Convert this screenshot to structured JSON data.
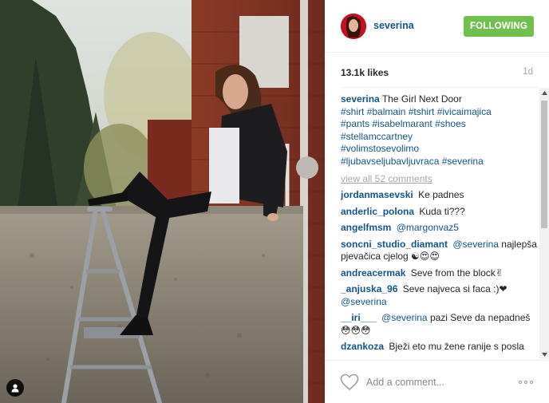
{
  "post": {
    "photo_label": "",
    "tag_icon": "person-tag-icon"
  },
  "header": {
    "username": "severina",
    "follow_label": "FOLLOWING",
    "follow_color": "#70c050"
  },
  "stats": {
    "likes": "13.1k likes",
    "age": "1d"
  },
  "caption": {
    "author": "severina",
    "text": "The Girl Next Door",
    "hashtag_lines": [
      "#shirt #balmain #tshirt #ivicaimajica",
      "#pants #isabelmarant #shoes",
      "#stellamccartney",
      "#volimstosevolimo",
      "#ljubavseljubavljuvraca #severina"
    ]
  },
  "view_all": "view all 52 comments",
  "comments": [
    {
      "user": "jordanmasevski",
      "mention": "",
      "text": "Ke padnes"
    },
    {
      "user": "anderlic_polona",
      "mention": "",
      "text": "Kuda ti???"
    },
    {
      "user": "angelfmsm",
      "mention": "@margonvaz5",
      "text": ""
    },
    {
      "user": "soncni_studio_diamant",
      "mention": "@severina",
      "text": "najlepša pjevačica cjelog ☯😍😍"
    },
    {
      "user": "andreacermak",
      "mention": "",
      "text": "Seve from the block✌"
    },
    {
      "user": "_anjuska_96",
      "mention": "@severina",
      "text": "Seve najveca si faca :)❤"
    },
    {
      "user": "__iri___",
      "mention": "@severina",
      "text": "pazi Seve da nepadneš 😳😳😳"
    },
    {
      "user": "dzankoza",
      "mention": "",
      "text": "Bježi eto mu žene ranije s posla"
    }
  ],
  "footer": {
    "comment_placeholder": "Add a comment...",
    "heart_icon": "heart-icon",
    "more_icon": "more-options-icon"
  },
  "colors": {
    "link": "#125688",
    "muted": "#a5a7aa",
    "border": "#efefef"
  }
}
